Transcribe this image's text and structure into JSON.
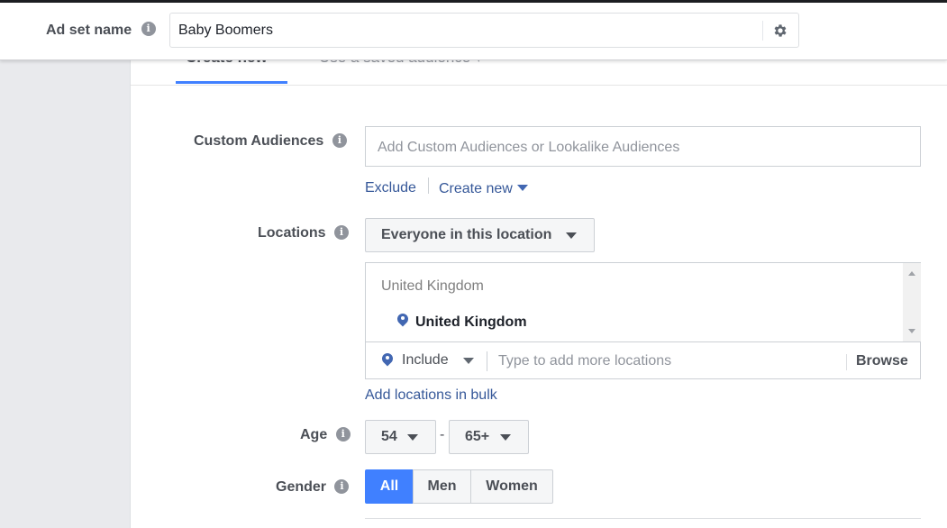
{
  "adset": {
    "label": "Ad set name",
    "value": "Baby Boomers"
  },
  "tabs": [
    {
      "label": "Create new"
    },
    {
      "label": "Use a saved audience ▾"
    }
  ],
  "custom_audiences": {
    "label": "Custom Audiences",
    "placeholder": "Add Custom Audiences or Lookalike Audiences",
    "exclude_link": "Exclude",
    "create_new_link": "Create new"
  },
  "locations": {
    "label": "Locations",
    "dropdown_value": "Everyone in this location",
    "group_title": "United Kingdom",
    "selected_item": "United Kingdom",
    "include_label": "Include",
    "placeholder": "Type to add more locations",
    "browse_label": "Browse",
    "bulk_link": "Add locations in bulk"
  },
  "age": {
    "label": "Age",
    "min": "54",
    "separator": "-",
    "max": "65+"
  },
  "gender": {
    "label": "Gender",
    "options": [
      "All",
      "Men",
      "Women"
    ],
    "selected": "All"
  },
  "colors": {
    "accent": "#4080ff",
    "link": "#365899",
    "pin": "#4267b2"
  },
  "icons": {
    "info": "info-icon",
    "settings": "gear-icon",
    "location": "location-pin-icon"
  }
}
